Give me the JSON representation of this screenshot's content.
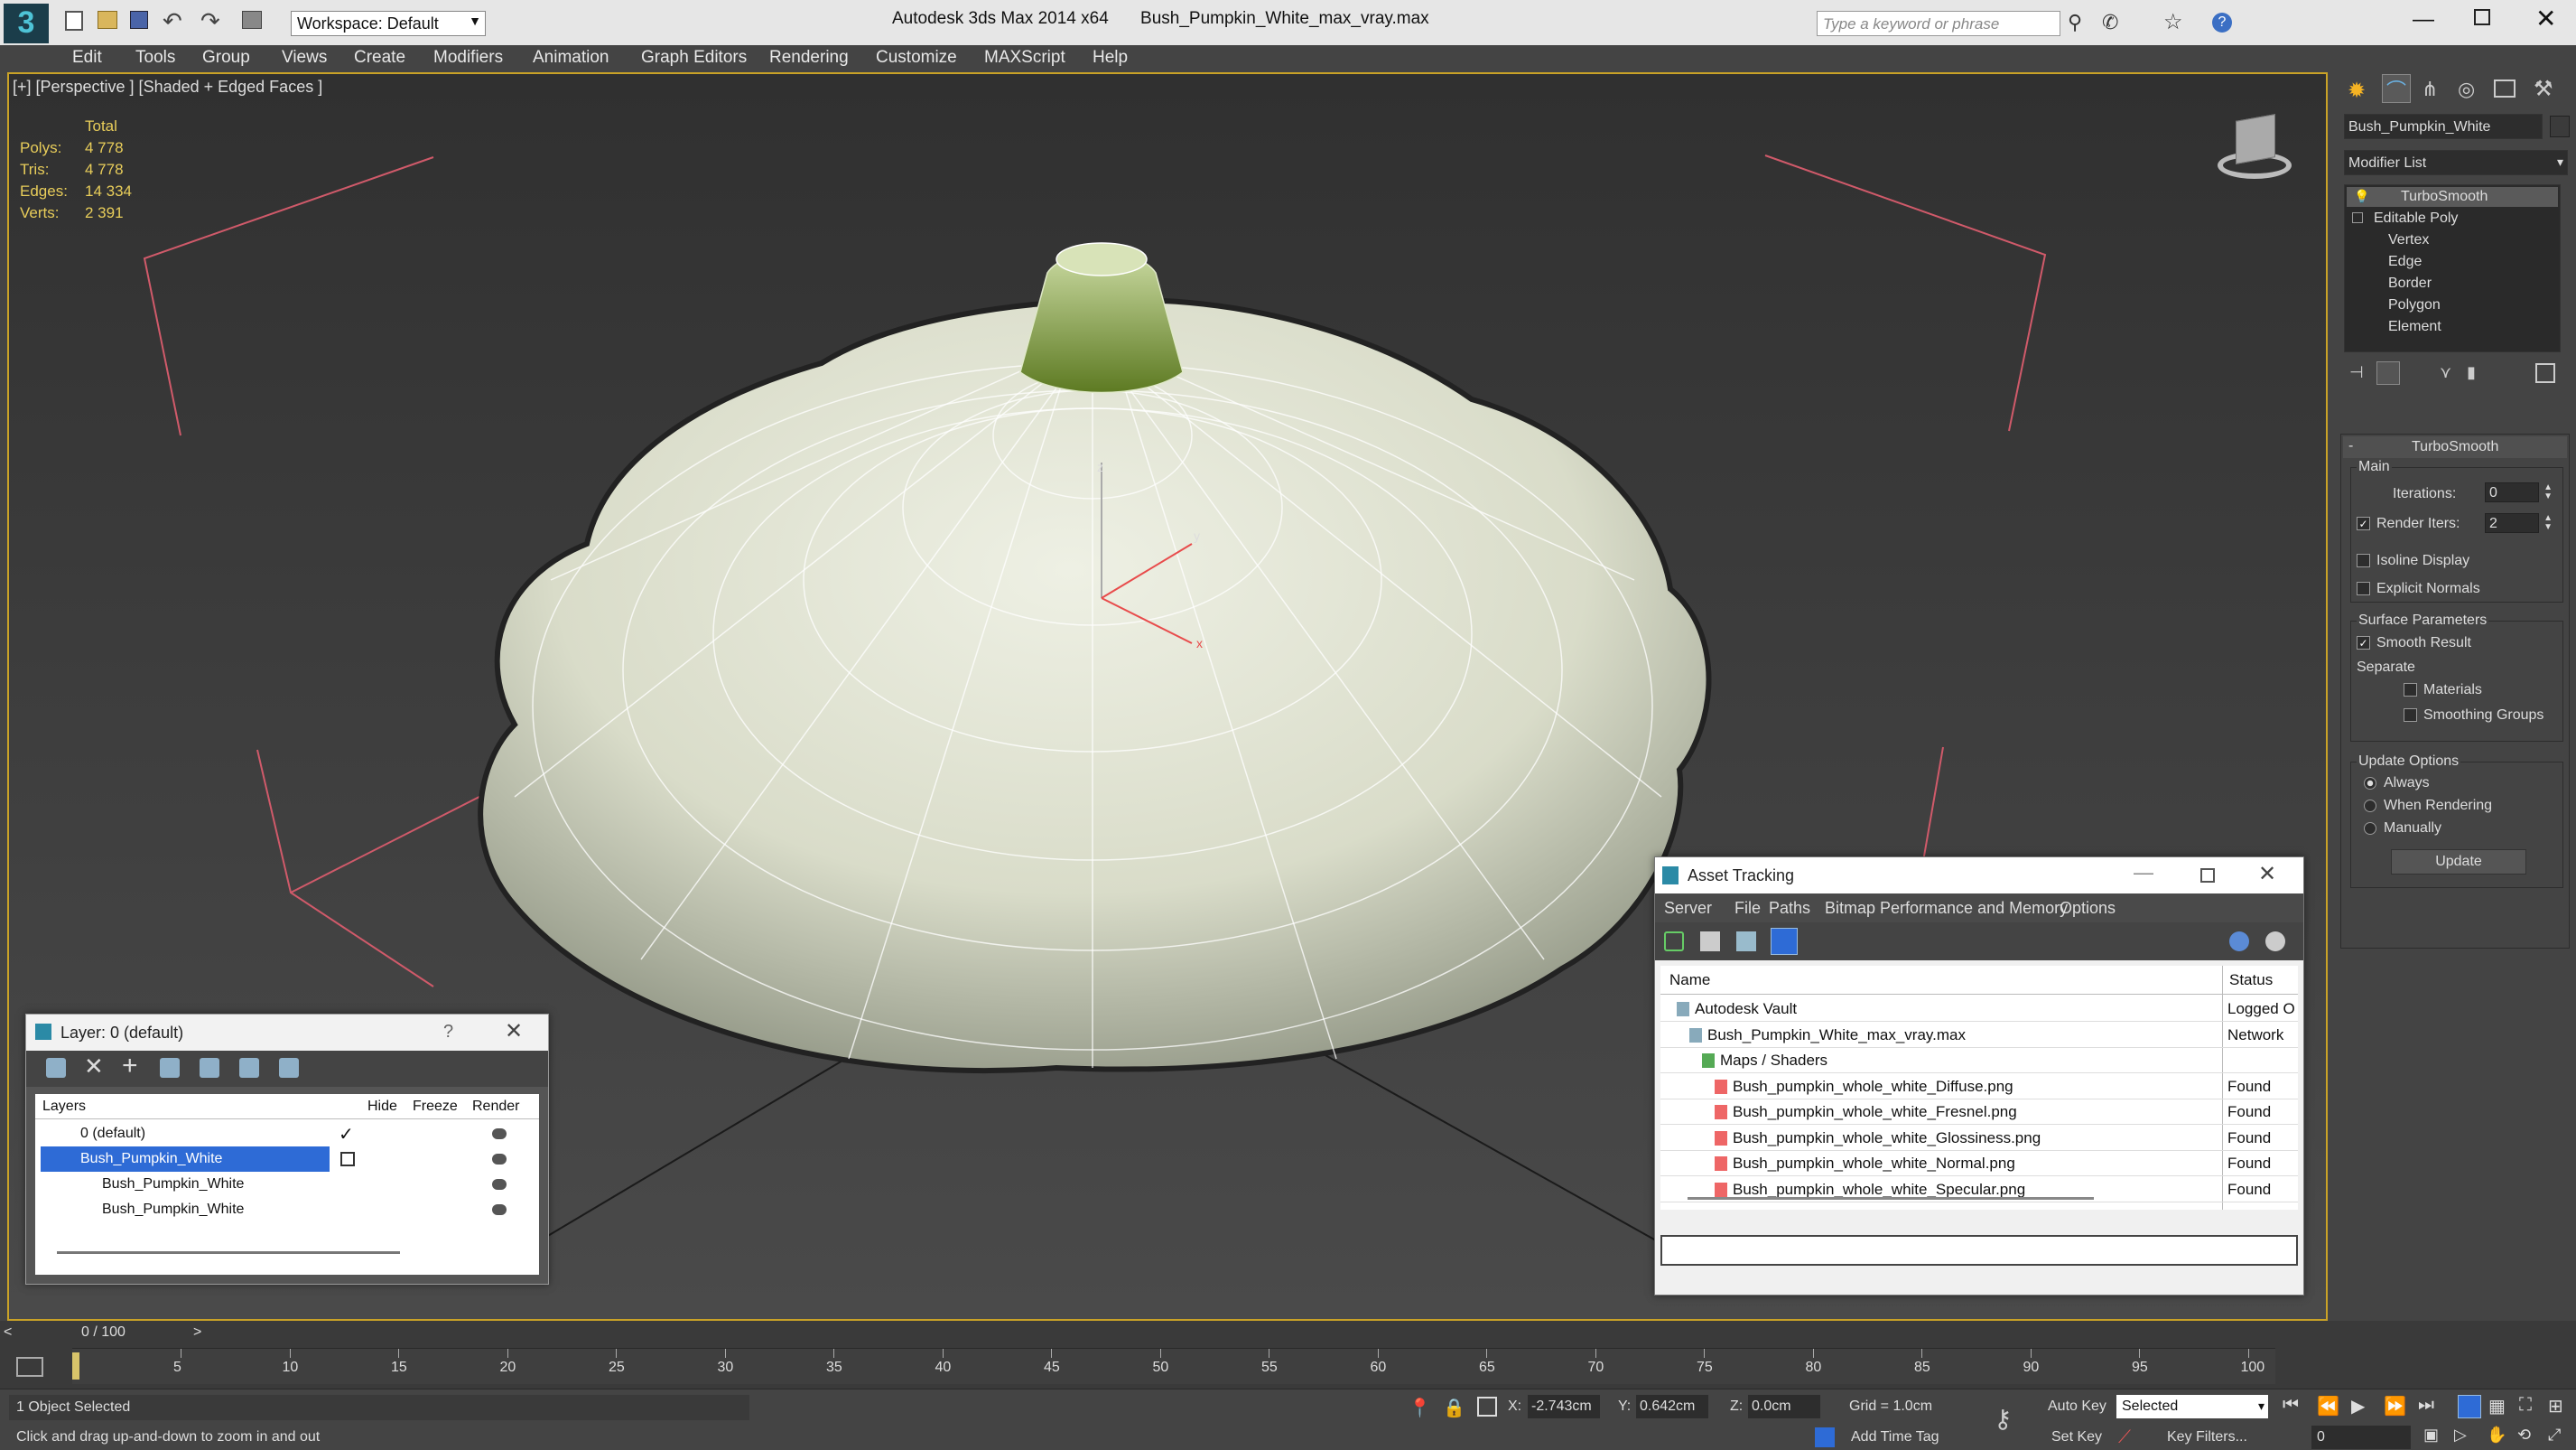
{
  "app": {
    "title": "Autodesk 3ds Max  2014 x64",
    "file": "Bush_Pumpkin_White_max_vray.max",
    "workspace": "Workspace: Default",
    "search_placeholder": "Type a keyword or phrase"
  },
  "menu": [
    "Edit",
    "Tools",
    "Group",
    "Views",
    "Create",
    "Modifiers",
    "Animation",
    "Graph Editors",
    "Rendering",
    "Customize",
    "MAXScript",
    "Help"
  ],
  "viewport": {
    "label": "[+] [Perspective ] [Shaded + Edged Faces ]",
    "stats": {
      "header": "Total",
      "rows": [
        {
          "label": "Polys:",
          "value": "4 778"
        },
        {
          "label": "Tris:",
          "value": "4 778"
        },
        {
          "label": "Edges:",
          "value": "14 334"
        },
        {
          "label": "Verts:",
          "value": "2 391"
        }
      ]
    }
  },
  "command_panel": {
    "object_name": "Bush_Pumpkin_White",
    "modifier_list": "Modifier List",
    "stack": [
      "TurboSmooth",
      "Editable Poly",
      "Vertex",
      "Edge",
      "Border",
      "Polygon",
      "Element"
    ],
    "rollout_title": "TurboSmooth",
    "main_label": "Main",
    "iterations_label": "Iterations:",
    "iterations_value": "0",
    "render_iters_label": "Render Iters:",
    "render_iters_value": "2",
    "isoline": "Isoline Display",
    "explicit_normals": "Explicit Normals",
    "surface_params": "Surface Parameters",
    "smooth_result": "Smooth Result",
    "separate": "Separate",
    "materials": "Materials",
    "smoothing_groups": "Smoothing Groups",
    "update_options": "Update Options",
    "always": "Always",
    "when_rendering": "When Rendering",
    "manually": "Manually",
    "update_button": "Update"
  },
  "layer_window": {
    "title": "Layer: 0 (default)",
    "help": "?",
    "columns": [
      "Layers",
      "Hide",
      "Freeze",
      "Render"
    ],
    "rows": [
      "0 (default)",
      "Bush_Pumpkin_White",
      "Bush_Pumpkin_White",
      "Bush_Pumpkin_White"
    ]
  },
  "asset_window": {
    "title": "Asset Tracking",
    "menu": [
      "Server",
      "File",
      "Paths",
      "Bitmap Performance and Memory",
      "Options"
    ],
    "columns": [
      "Name",
      "Status"
    ],
    "rows": [
      {
        "name": "Autodesk Vault",
        "status": "Logged O",
        "indent": 1
      },
      {
        "name": "Bush_Pumpkin_White_max_vray.max",
        "status": "Network",
        "indent": 2
      },
      {
        "name": "Maps / Shaders",
        "status": "",
        "indent": 3
      },
      {
        "name": "Bush_pumpkin_whole_white_Diffuse.png",
        "status": "Found",
        "indent": 4
      },
      {
        "name": "Bush_pumpkin_whole_white_Fresnel.png",
        "status": "Found",
        "indent": 4
      },
      {
        "name": "Bush_pumpkin_whole_white_Glossiness.png",
        "status": "Found",
        "indent": 4
      },
      {
        "name": "Bush_pumpkin_whole_white_Normal.png",
        "status": "Found",
        "indent": 4
      },
      {
        "name": "Bush_pumpkin_whole_white_Specular.png",
        "status": "Found",
        "indent": 4
      }
    ]
  },
  "timeline": {
    "frame": "0 / 100",
    "ticks": [
      "5",
      "10",
      "15",
      "20",
      "25",
      "30",
      "35",
      "40",
      "45",
      "50",
      "55",
      "60",
      "65",
      "70",
      "75",
      "80",
      "85",
      "90",
      "95",
      "100"
    ]
  },
  "status": {
    "selected": "1 Object Selected",
    "prompt": "Click and drag up-and-down to zoom in and out",
    "x_label": "X:",
    "x_value": "-2.743cm",
    "y_label": "Y:",
    "y_value": "0.642cm",
    "z_label": "Z:",
    "z_value": "0.0cm",
    "grid": "Grid = 1.0cm",
    "add_time_tag": "Add Time Tag",
    "auto_key": "Auto Key",
    "set_key": "Set Key",
    "selected_dropdown": "Selected",
    "key_filters": "Key Filters...",
    "frame_field": "0"
  },
  "colors": {
    "accent": "#c9a227",
    "selection": "#2e6bd6",
    "found": "#111111"
  }
}
